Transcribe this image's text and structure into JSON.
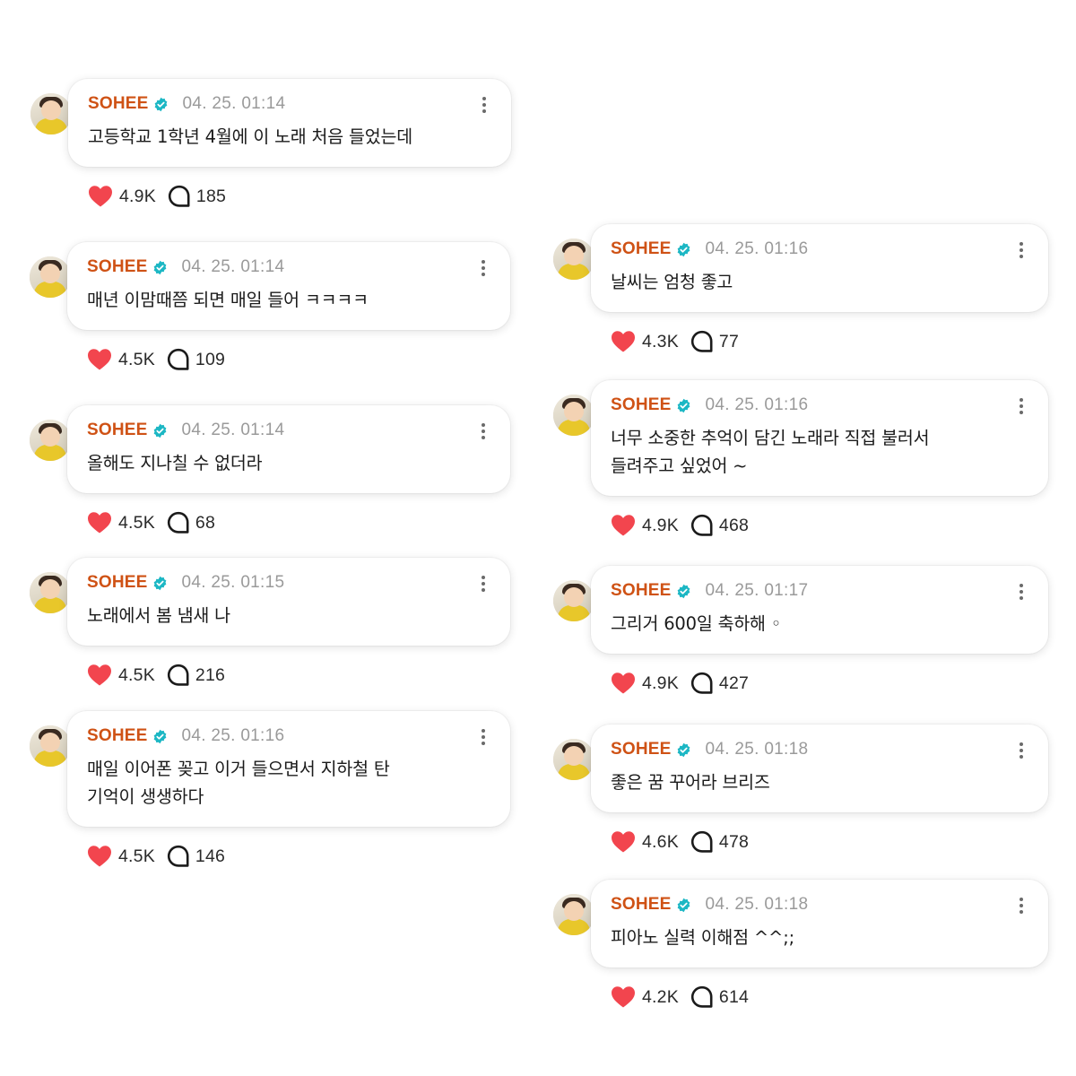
{
  "colors": {
    "name": "#cf5215",
    "verified": "#1cb7c4",
    "heart": "#f2454e",
    "time": "#9a9a9a"
  },
  "icons": {
    "verified": "verified-badge-icon",
    "more": "more-vertical-icon",
    "like": "heart-icon",
    "comment": "comment-bubble-icon"
  },
  "left": [
    {
      "name": "SOHEE",
      "time": "04. 25. 01:14",
      "text": "고등학교 1학년 4월에 이 노래 처음 들었는데",
      "likes": "4.9K",
      "comments": "185"
    },
    {
      "name": "SOHEE",
      "time": "04. 25. 01:14",
      "text": "매년 이맘때쯤 되면 매일 들어 ㅋㅋㅋㅋ",
      "likes": "4.5K",
      "comments": "109"
    },
    {
      "name": "SOHEE",
      "time": "04. 25. 01:14",
      "text": "올해도 지나칠 수 없더라",
      "likes": "4.5K",
      "comments": "68"
    },
    {
      "name": "SOHEE",
      "time": "04. 25. 01:15",
      "text": "노래에서 봄 냄새 나",
      "likes": "4.5K",
      "comments": "216"
    },
    {
      "name": "SOHEE",
      "time": "04. 25. 01:16",
      "text": "매일 이어폰 꽂고 이거 들으면서 지하철 탄\n기억이 생생하다",
      "likes": "4.5K",
      "comments": "146"
    }
  ],
  "right": [
    {
      "name": "SOHEE",
      "time": "04. 25. 01:16",
      "text": "날씨는 엄청 좋고",
      "likes": "4.3K",
      "comments": "77"
    },
    {
      "name": "SOHEE",
      "time": "04. 25. 01:16",
      "text": "너무 소중한 추억이 담긴 노래라 직접 불러서\n들려주고 싶었어 ~",
      "likes": "4.9K",
      "comments": "468"
    },
    {
      "name": "SOHEE",
      "time": "04. 25. 01:17",
      "text": "그리거 600일 축하해 ◦",
      "likes": "4.9K",
      "comments": "427"
    },
    {
      "name": "SOHEE",
      "time": "04. 25. 01:18",
      "text": "좋은 꿈 꾸어라 브리즈",
      "likes": "4.6K",
      "comments": "478"
    },
    {
      "name": "SOHEE",
      "time": "04. 25. 01:18",
      "text": "피아노 실력 이해점 ^^;;",
      "likes": "4.2K",
      "comments": "614"
    }
  ]
}
